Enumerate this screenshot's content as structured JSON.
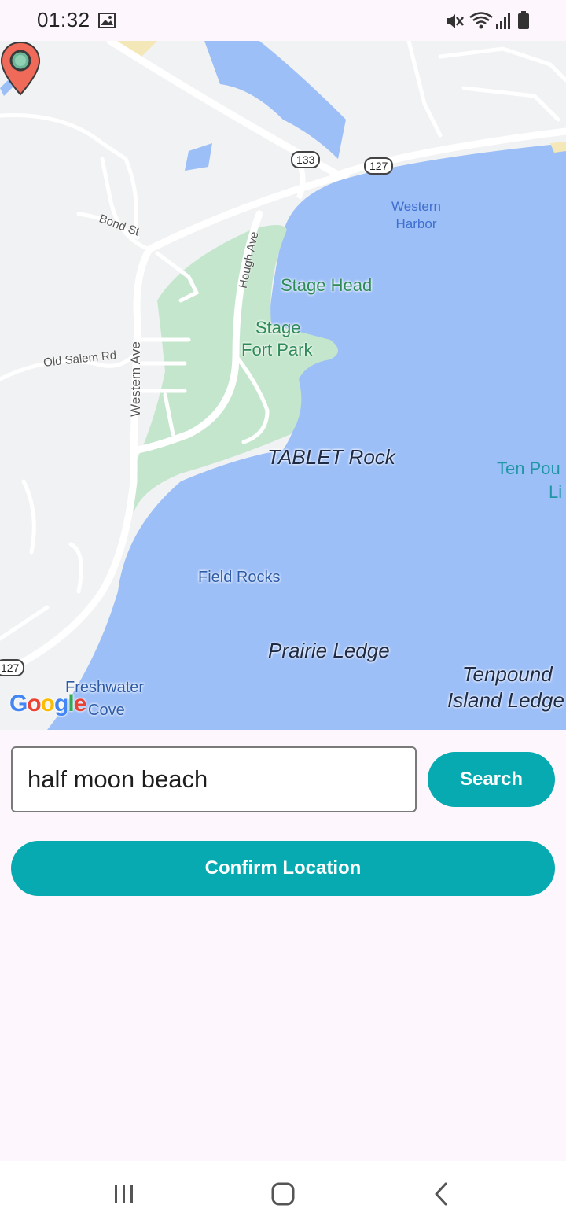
{
  "status_bar": {
    "time": "01:32",
    "icons": [
      "gallery-icon",
      "mute-icon",
      "wifi-icon",
      "signal-icon",
      "battery-icon"
    ]
  },
  "map": {
    "labels": {
      "western_harbor": "Western\nHarbor",
      "stage_head": "Stage Head",
      "stage_fort_park_1": "Stage",
      "stage_fort_park_2": "Fort Park",
      "tablet_rock": "TABLET Rock",
      "ten_pound_1": "Ten Pou",
      "ten_pound_2": "Li",
      "field_rocks": "Field Rocks",
      "prairie_ledge": "Prairie Ledge",
      "tenpound_ledge_1": "Tenpound",
      "tenpound_ledge_2": "Island Ledge",
      "freshwater_cove_1": "Freshwater",
      "freshwater_cove_2": "Cove",
      "bond_st": "Bond St",
      "hough_ave": "Hough Ave",
      "old_salem_rd": "Old Salem Rd",
      "western_ave": "Western Ave"
    },
    "route_shields": [
      "133",
      "127",
      "127"
    ],
    "attribution_letters": [
      "G",
      "o",
      "o",
      "g",
      "l",
      "e"
    ],
    "colors": {
      "water": "#9dbff7",
      "park": "#c4e6cd",
      "land": "#f1f2f3",
      "road": "#ffffff",
      "pin": "#ef6a58"
    },
    "marker_icon": "location-pin-icon"
  },
  "search": {
    "value": "half moon beach",
    "button_label": "Search"
  },
  "confirm": {
    "label": "Confirm Location"
  },
  "accent_color": "#06aab0",
  "nav_bar": {
    "icons": [
      "recent-apps-icon",
      "home-icon",
      "back-icon"
    ]
  }
}
